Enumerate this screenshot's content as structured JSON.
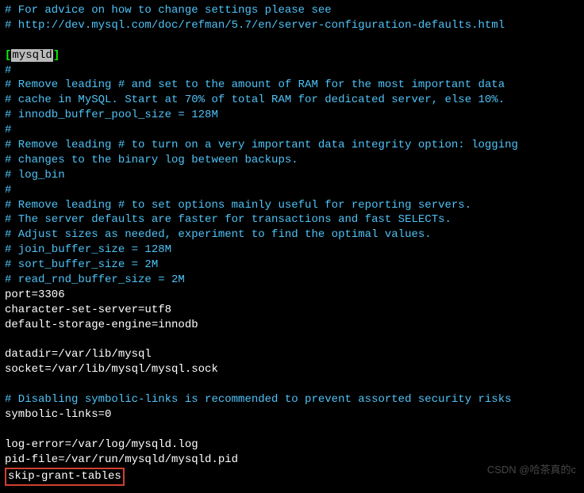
{
  "lines": [
    {
      "type": "comment",
      "text": "# For advice on how to change settings please see"
    },
    {
      "type": "comment",
      "text": "# http://dev.mysql.com/doc/refman/5.7/en/server-configuration-defaults.html"
    },
    {
      "type": "blank",
      "text": ""
    },
    {
      "type": "section",
      "open": "[",
      "name": "mysqld",
      "close": "]"
    },
    {
      "type": "comment",
      "text": "#"
    },
    {
      "type": "comment",
      "text": "# Remove leading # and set to the amount of RAM for the most important data"
    },
    {
      "type": "comment",
      "text": "# cache in MySQL. Start at 70% of total RAM for dedicated server, else 10%."
    },
    {
      "type": "comment",
      "text": "# innodb_buffer_pool_size = 128M"
    },
    {
      "type": "comment",
      "text": "#"
    },
    {
      "type": "comment",
      "text": "# Remove leading # to turn on a very important data integrity option: logging"
    },
    {
      "type": "comment",
      "text": "# changes to the binary log between backups."
    },
    {
      "type": "comment",
      "text": "# log_bin"
    },
    {
      "type": "comment",
      "text": "#"
    },
    {
      "type": "comment",
      "text": "# Remove leading # to set options mainly useful for reporting servers."
    },
    {
      "type": "comment",
      "text": "# The server defaults are faster for transactions and fast SELECTs."
    },
    {
      "type": "comment",
      "text": "# Adjust sizes as needed, experiment to find the optimal values."
    },
    {
      "type": "comment",
      "text": "# join_buffer_size = 128M"
    },
    {
      "type": "comment",
      "text": "# sort_buffer_size = 2M"
    },
    {
      "type": "comment",
      "text": "# read_rnd_buffer_size = 2M"
    },
    {
      "type": "setting",
      "text": "port=3306"
    },
    {
      "type": "setting",
      "text": "character-set-server=utf8"
    },
    {
      "type": "setting",
      "text": "default-storage-engine=innodb"
    },
    {
      "type": "blank",
      "text": ""
    },
    {
      "type": "setting",
      "text": "datadir=/var/lib/mysql"
    },
    {
      "type": "setting",
      "text": "socket=/var/lib/mysql/mysql.sock"
    },
    {
      "type": "blank",
      "text": ""
    },
    {
      "type": "comment",
      "text": "# Disabling symbolic-links is recommended to prevent assorted security risks"
    },
    {
      "type": "setting",
      "text": "symbolic-links=0"
    },
    {
      "type": "blank",
      "text": ""
    },
    {
      "type": "setting",
      "text": "log-error=/var/log/mysqld.log"
    },
    {
      "type": "setting",
      "text": "pid-file=/var/run/mysqld/mysqld.pid"
    },
    {
      "type": "highlighted",
      "text": "skip-grant-tables"
    }
  ],
  "watermark": "CSDN @哈茶真的c"
}
